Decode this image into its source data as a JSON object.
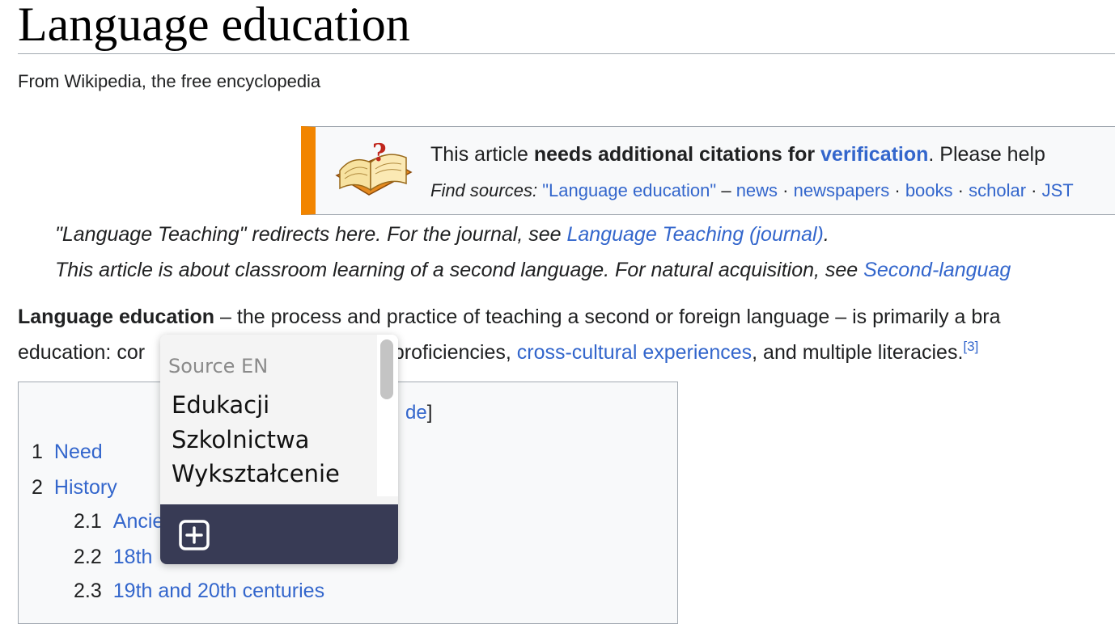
{
  "page": {
    "title": "Language education",
    "tagline": "From Wikipedia, the free encyclopedia"
  },
  "ambox": {
    "icon": "open-book-question-icon",
    "accent_color": "#f28500",
    "line1_prefix": "This article ",
    "line1_bold": "needs additional citations for ",
    "line1_link": "verification",
    "line1_suffix": ". Please help",
    "find_label": "Find sources:",
    "find_query": "\"Language education\"",
    "find_dash": " – ",
    "sources": [
      "news",
      "newspapers",
      "books",
      "scholar",
      "JST"
    ],
    "separator": " · "
  },
  "hatnotes": {
    "line1_text": "\"Language Teaching\" redirects here. For the journal, see ",
    "line1_link": "Language Teaching (journal)",
    "line1_end": ".",
    "line2_text": "This article is about classroom learning of a second language. For natural acquisition, see ",
    "line2_link": "Second-languag"
  },
  "lead": {
    "bold": "Language education",
    "line1_rest": " – the process and practice of teaching a second or foreign language – is primarily a bra",
    "line2_start": "education: cor",
    "line2_mid": "ies, proficiencies, ",
    "line2_link": "cross-cultural experiences",
    "line2_end": ", and multiple literacies.",
    "ref": "[3]"
  },
  "toc": {
    "hide_fragment": "de",
    "hide_bracket": "]",
    "items": [
      {
        "num": "1",
        "label": "Need"
      },
      {
        "num": "2",
        "label": "History"
      },
      {
        "num": "2.1",
        "label": "Ancie"
      },
      {
        "num": "2.2",
        "label": "18th"
      },
      {
        "num": "2.3",
        "label": "19th and 20th centuries"
      }
    ]
  },
  "popup": {
    "source_label": "Source EN",
    "translations": [
      "Edukacji",
      "Szkolnictwa",
      "Wykształcenie"
    ],
    "add_icon": "plus-square-icon",
    "footer_color": "#383b55"
  }
}
